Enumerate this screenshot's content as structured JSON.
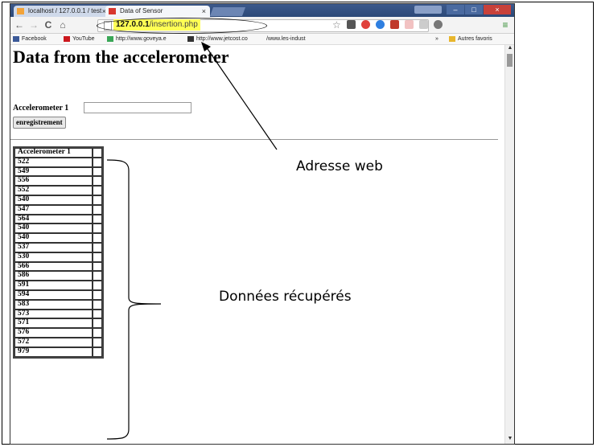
{
  "browser": {
    "tabs": [
      {
        "label": "localhost / 127.0.0.1 / test"
      },
      {
        "label": "Data of Sensor"
      }
    ],
    "url": {
      "host": "127.0.0.1",
      "path": "/insertion.php"
    },
    "bookmarks": [
      {
        "label": "Facebook",
        "color": "#3b5998"
      },
      {
        "label": "YouTube",
        "color": "#cc181e"
      },
      {
        "label": "http://www.goveya.e",
        "color": "#3aa757"
      },
      {
        "label": "http://www.jetcost.co",
        "color": "#333333"
      },
      {
        "label": "/www.les-indust",
        "color": "#ffffff"
      },
      {
        "label": "Autres favoris",
        "color": "#e8b62c"
      }
    ],
    "bookmarks_more": "»"
  },
  "page": {
    "title": "Data from the accelerometer",
    "form": {
      "label": "Accelerometer 1",
      "input_value": "",
      "button_label": "enregistrement"
    },
    "table": {
      "header": "Accelerometer 1",
      "rows": [
        "522",
        "549",
        "556",
        "552",
        "540",
        "547",
        "564",
        "540",
        "540",
        "537",
        "530",
        "566",
        "586",
        "591",
        "594",
        "583",
        "573",
        "571",
        "576",
        "572",
        "979"
      ]
    }
  },
  "annotations": {
    "address": "Adresse web",
    "data": "Données récupérés"
  }
}
